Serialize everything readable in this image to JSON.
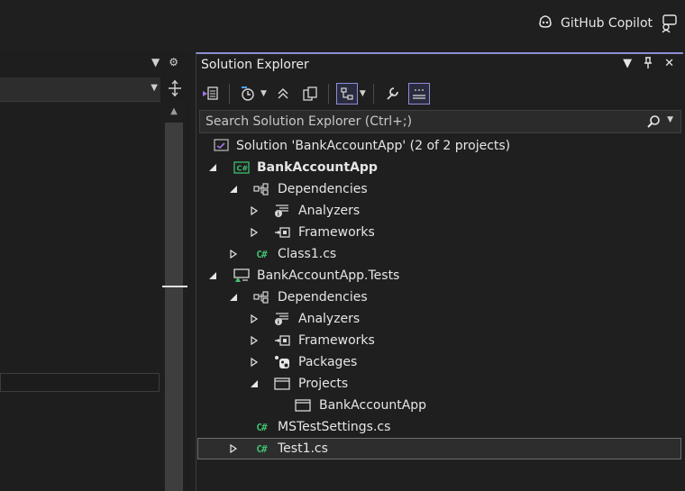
{
  "top": {
    "copilot_label": "GitHub Copilot"
  },
  "solution_explorer": {
    "title": "Solution Explorer",
    "search_placeholder": "Search Solution Explorer (Ctrl+;)",
    "tree": {
      "solution": "Solution 'BankAccountApp' (2 of 2 projects)",
      "project1": "BankAccountApp",
      "p1_dependencies": "Dependencies",
      "p1_analyzers": "Analyzers",
      "p1_frameworks": "Frameworks",
      "p1_class1": "Class1.cs",
      "project2": "BankAccountApp.Tests",
      "p2_dependencies": "Dependencies",
      "p2_analyzers": "Analyzers",
      "p2_frameworks": "Frameworks",
      "p2_packages": "Packages",
      "p2_projects": "Projects",
      "p2_projects_ref": "BankAccountApp",
      "p2_mstest": "MSTestSettings.cs",
      "p2_test1": "Test1.cs"
    },
    "selected_item": "Test1.cs"
  },
  "colors": {
    "background": "#1f1f1f",
    "accent": "#8d8dd8",
    "csharp_icon": "#3fbf6f",
    "solution_icon": "#a875e6"
  },
  "icons": [
    "github-copilot-icon",
    "feedback-icon",
    "dropdown-caret-icon",
    "gear-icon",
    "pin-icon",
    "close-icon",
    "switch-views-icon",
    "history-icon",
    "collapse-all-icon",
    "copy-icon",
    "show-all-files-icon",
    "properties-wrench-icon",
    "preview-selected-icon",
    "search-icon",
    "solution-icon",
    "csharp-project-icon",
    "dependencies-icon",
    "analyzers-icon",
    "frameworks-icon",
    "csharp-file-icon",
    "test-project-icon",
    "packages-icon",
    "projects-folder-icon",
    "project-reference-icon",
    "expand-arrow-icon",
    "collapse-arrow-icon"
  ]
}
